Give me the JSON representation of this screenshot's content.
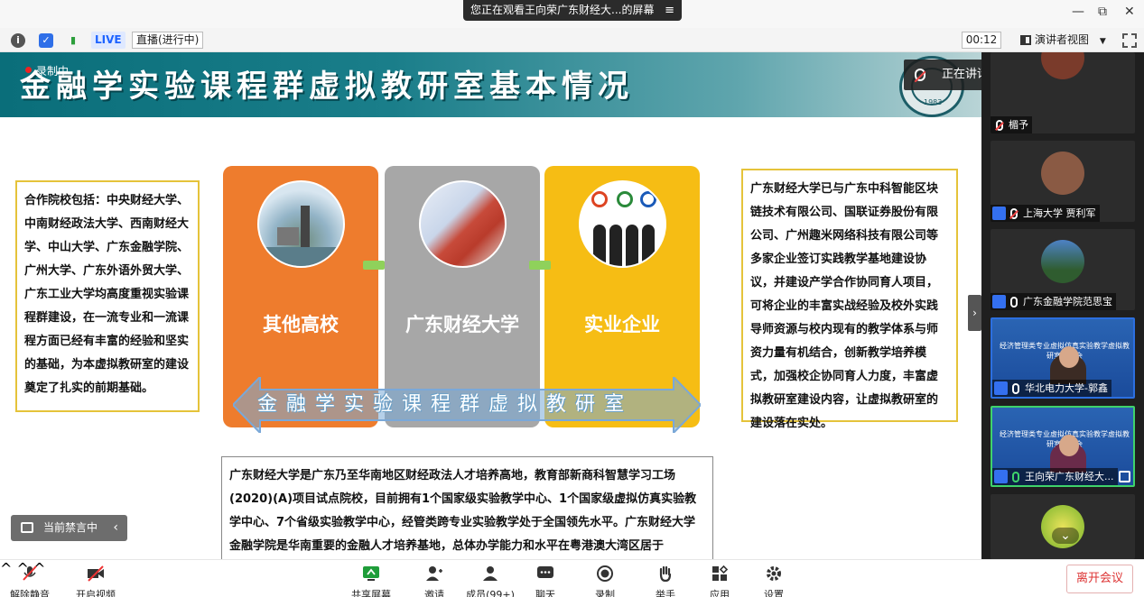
{
  "window": {
    "share_banner": "您正在观看王向荣广东财经大...的屏幕",
    "share_menu_icon": "≡",
    "controls": {
      "minimize": "—",
      "restore": "⧉",
      "close": "✕"
    }
  },
  "infobar": {
    "live_label": "LIVE",
    "live_status": "直播(进行中)",
    "timer": "00:12",
    "view_mode": "演讲者视图"
  },
  "slide": {
    "title": "金融学实验课程群虚拟教研室基本情况",
    "record_label": "录制中",
    "seal_year": "1983",
    "speaking": "正在讲话: 王向荣广东财经大学;...",
    "left_text": "合作院校包括：中央财经大学、中南财经政法大学、西南财经大学、中山大学、广东金融学院、广州大学、广东外语外贸大学、广东工业大学均高度重视实验课程群建设，在一流专业和一流课程方面已经有丰富的经验和坚实的基础，为本虚拟教研室的建设奠定了扎实的前期基础。",
    "right_text": "广东财经大学已与广东中科智能区块链技术有限公司、国联证券股份有限公司、广州趣米网络科技有限公司等多家企业签订实践教学基地建设协议，并建设产学合作协同育人项目，可将企业的丰富实战经验及校外实践导师资源与校内现有的教学体系与师资力量有机结合，创新教学培养模式，加强校企协同育人力度，丰富虚拟教研室建设内容，让虚拟教研室的建设落在实处。",
    "bottom_text": "广东财经大学是广东乃至华南地区财经政法人才培养高地，教育部新商科智慧学习工场(2020)(A)项目试点院校，目前拥有1个国家级实验教学中心、1个国家级虚拟仿真实验教学中心、7个省级实验教学中心，经管类跨专业实验教学处于全国领先水平。广东财经大学金融学院是华南重要的金融人才培养基地，总体办学能力和水平在粤港澳大湾区居于",
    "cards": [
      {
        "label": "其他高校"
      },
      {
        "label": "广东财经大学"
      },
      {
        "label": "实业企业"
      }
    ],
    "arrow_text": "金融学实验课程群虚拟教研室"
  },
  "mute_banner": {
    "label": "当前禁言中"
  },
  "participants": [
    {
      "name": "楣予",
      "mic": "off"
    },
    {
      "name": "上海大学 贾利军",
      "mic": "off"
    },
    {
      "name": "广东金融学院范思宝",
      "mic": "on"
    },
    {
      "name": "华北电力大学-郭鑫",
      "mic": "on",
      "slide_text": "经济管理类专业虚拟仿真实验教学虚拟教研室研讨会"
    },
    {
      "name": "王向荣广东财经大...",
      "mic": "on",
      "slide_text": "经济管理类专业虚拟仿真实验教学虚拟教研室研讨会"
    }
  ],
  "toolbar": {
    "unmute": "解除静音",
    "start_video": "开启视频",
    "share_screen": "共享屏幕",
    "invite": "邀请",
    "members": "成员(99+)",
    "chat": "聊天",
    "record": "录制",
    "raise_hand": "举手",
    "apps": "应用",
    "settings": "设置",
    "leave": "离开会议"
  },
  "colors": {
    "card_orange": "#ee7c2d",
    "card_gray": "#a7a7a7",
    "card_yellow": "#f6bd14",
    "header_teal": "#0a6e7a",
    "live_blue": "#1d63ff",
    "leave_red": "#d33"
  }
}
